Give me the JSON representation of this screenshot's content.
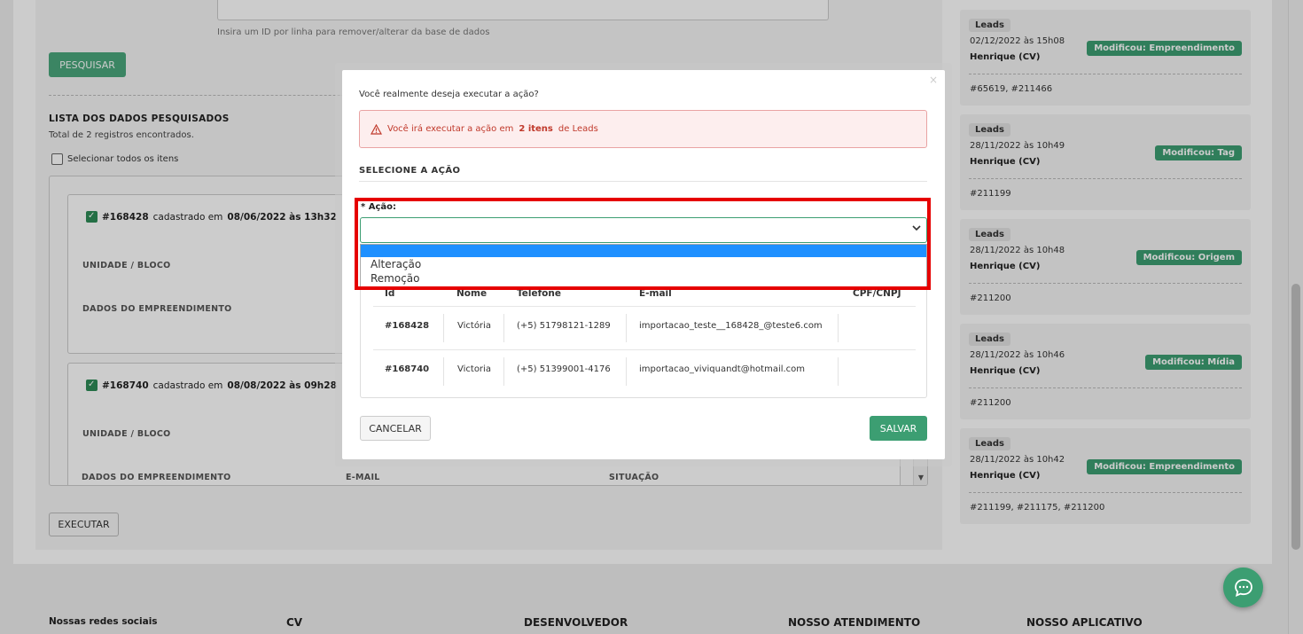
{
  "background": {
    "help_text": "Insira um ID por linha para remover/alterar da base de dados",
    "search_button": "PESQUISAR",
    "list_title": "LISTA DOS DADOS PESQUISADOS",
    "list_subtitle": "Total de 2 registros encontrados.",
    "select_all": "Selecionar todos os itens",
    "records": [
      {
        "id": "#168428",
        "mid": "cadastrado em",
        "date": "08/06/2022 às 13h32"
      },
      {
        "id": "#168740",
        "mid": "cadastrado em",
        "date": "08/08/2022 às 09h28"
      }
    ],
    "labels": {
      "unit": "UNIDADE / BLOCO",
      "project": "DADOS DO EMPREENDIMENTO",
      "email": "E-MAIL",
      "status": "SITUAÇÃO"
    },
    "execute_button": "EXECUTAR"
  },
  "history": [
    {
      "tag": "Leads",
      "date": "02/12/2022 às 15h08",
      "user": "Henrique (CV)",
      "badge": "Modificou: Empreendimento",
      "ids": "#65619, #211466"
    },
    {
      "tag": "Leads",
      "date": "28/11/2022 às 10h49",
      "user": "Henrique (CV)",
      "badge": "Modificou: Tag",
      "ids": "#211199"
    },
    {
      "tag": "Leads",
      "date": "28/11/2022 às 10h48",
      "user": "Henrique (CV)",
      "badge": "Modificou: Origem",
      "ids": "#211200"
    },
    {
      "tag": "Leads",
      "date": "28/11/2022 às 10h46",
      "user": "Henrique (CV)",
      "badge": "Modificou: Mídia",
      "ids": "#211200"
    },
    {
      "tag": "Leads",
      "date": "28/11/2022 às 10h42",
      "user": "Henrique (CV)",
      "badge": "Modificou: Empreendimento",
      "ids": "#211199, #211175, #211200"
    }
  ],
  "footer": {
    "social": "Nossas redes sociais",
    "cv": "CV",
    "dev": "DESENVOLVEDOR",
    "support": "NOSSO ATENDIMENTO",
    "app": "NOSSO APLICATIVO"
  },
  "modal": {
    "close": "×",
    "confirm_text": "Você realmente deseja executar a ação?",
    "alert_pre": "Você irá executar a ação em",
    "alert_bold": "2 itens",
    "alert_post": "de Leads",
    "section_title": "SELECIONE A AÇÃO",
    "field_label": "* Ação:",
    "options": [
      "Alteração",
      "Remoção"
    ],
    "table_headers": [
      "Id",
      "Nome",
      "Telefone",
      "E-mail",
      "CPF/CNPJ"
    ],
    "rows": [
      {
        "id": "#168428",
        "name": "Victória",
        "phone": "(+5) 51798121-1289",
        "email": "importacao_teste__168428_@teste6.com"
      },
      {
        "id": "#168740",
        "name": "Victoria",
        "phone": "(+5) 51399001-4176",
        "email": "importacao_viviquandt@hotmail.com"
      }
    ],
    "cancel": "CANCELAR",
    "save": "SALVAR"
  }
}
